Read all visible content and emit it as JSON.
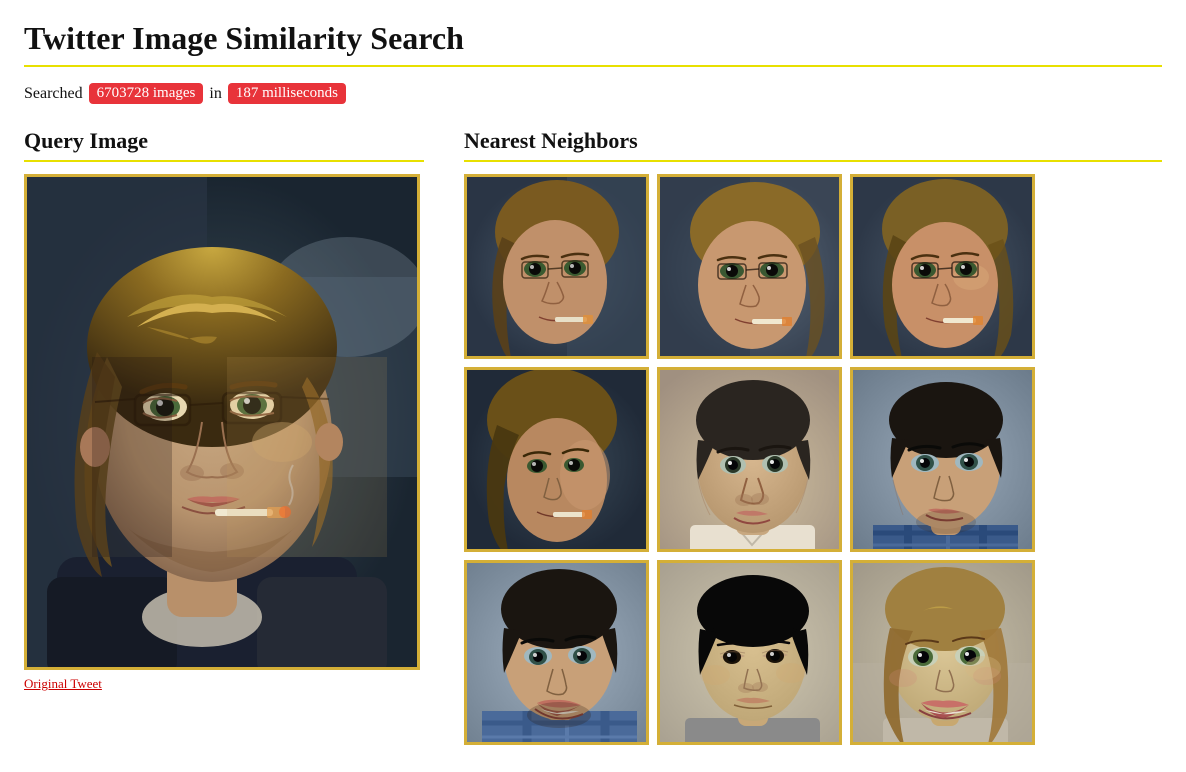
{
  "page": {
    "title": "Twitter Image Similarity Search"
  },
  "search": {
    "prefix": "Searched",
    "images_count": "6703728 images",
    "connector": "in",
    "time": "187 milliseconds"
  },
  "query_section": {
    "title": "Query Image",
    "original_tweet_label": "Original Tweet"
  },
  "neighbors_section": {
    "title": "Nearest Neighbors",
    "grid": [
      {
        "id": 1,
        "row": 1,
        "col": 1,
        "bg": "face-1"
      },
      {
        "id": 2,
        "row": 1,
        "col": 2,
        "bg": "face-2"
      },
      {
        "id": 3,
        "row": 1,
        "col": 3,
        "bg": "face-3"
      },
      {
        "id": 4,
        "row": 2,
        "col": 1,
        "bg": "face-4"
      },
      {
        "id": 5,
        "row": 2,
        "col": 2,
        "bg": "face-5"
      },
      {
        "id": 6,
        "row": 2,
        "col": 3,
        "bg": "face-6"
      },
      {
        "id": 7,
        "row": 3,
        "col": 1,
        "bg": "face-7"
      },
      {
        "id": 8,
        "row": 3,
        "col": 2,
        "bg": "face-8"
      },
      {
        "id": 9,
        "row": 3,
        "col": 3,
        "bg": "face-9"
      }
    ]
  }
}
